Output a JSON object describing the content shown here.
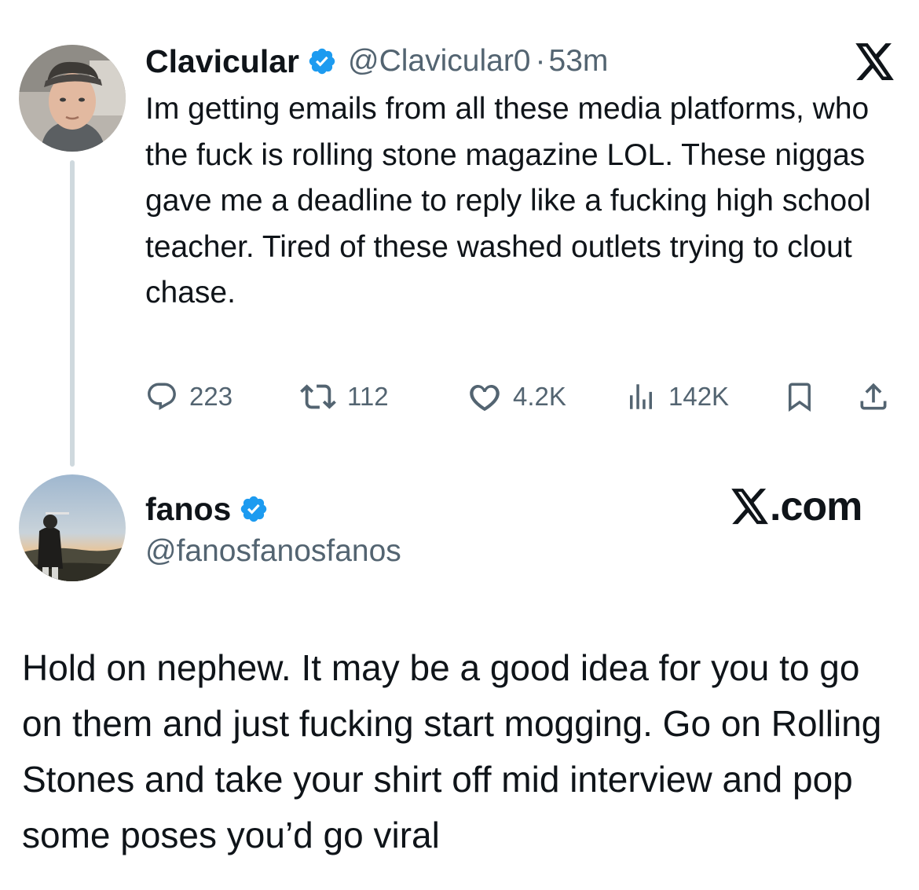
{
  "tweet": {
    "author_name": "Clavicular",
    "author_handle": "@Clavicular0",
    "separator": "·",
    "time": "53m",
    "text": "Im getting emails from all these media platforms, who the fuck is rolling stone magazine LOL. These niggas gave me a deadline to reply like a fucking high school teacher. Tired of these washed outlets trying to clout chase.",
    "verified": true,
    "stats": {
      "replies": "223",
      "reposts": "112",
      "likes": "4.2K",
      "views": "142K"
    },
    "icons": [
      "reply-icon",
      "repost-icon",
      "like-icon",
      "views-icon",
      "bookmark-icon",
      "share-icon",
      "x-logo-icon",
      "verified-badge-icon"
    ]
  },
  "reply": {
    "author_name": "fanos",
    "author_handle": "@fanosfanosfanos",
    "verified": true,
    "site_label": ".com",
    "text": "Hold on nephew. It may be a good idea for you to go on them and just fucking start mogging. Go on Rolling Stones and take your shirt off mid interview and pop some poses you’d go viral"
  },
  "colors": {
    "text": "#0f1419",
    "secondary": "#536471",
    "verified": "#1d9bf0",
    "thread_line": "#cfd9de",
    "background": "#ffffff"
  }
}
